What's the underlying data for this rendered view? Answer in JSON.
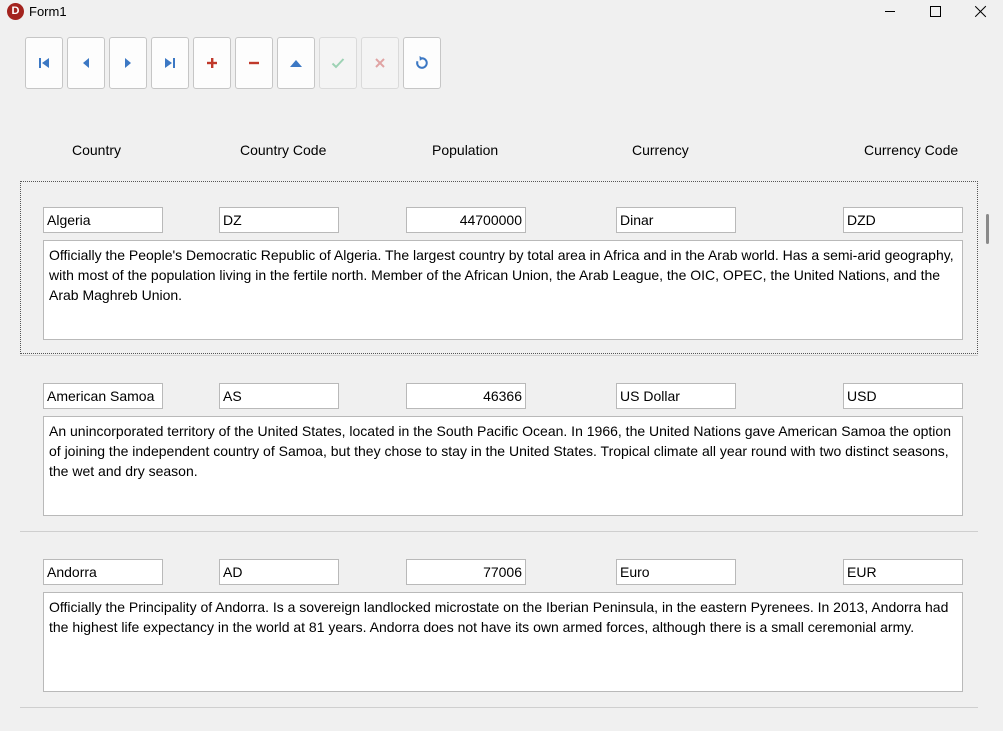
{
  "window": {
    "title": "Form1",
    "icon_letter": "D"
  },
  "navigator": {
    "buttons": [
      {
        "name": "first-record",
        "icon": "first-icon"
      },
      {
        "name": "prior-record",
        "icon": "prior-icon"
      },
      {
        "name": "next-record",
        "icon": "next-icon"
      },
      {
        "name": "last-record",
        "icon": "last-icon"
      },
      {
        "name": "insert-record",
        "icon": "plus-icon"
      },
      {
        "name": "delete-record",
        "icon": "minus-icon"
      },
      {
        "name": "edit-record",
        "icon": "up-icon"
      },
      {
        "name": "post-record",
        "icon": "check-icon",
        "enabled": false
      },
      {
        "name": "cancel-record",
        "icon": "x-icon",
        "enabled": false
      },
      {
        "name": "refresh-record",
        "icon": "refresh-icon"
      }
    ],
    "colors": {
      "nav": "#3c78c4",
      "danger": "#c0392b",
      "disabled_check": "#9dd2b4",
      "disabled_x": "#e0a3a3"
    }
  },
  "headers": {
    "country": "Country",
    "country_code": "Country Code",
    "population": "Population",
    "currency": "Currency",
    "currency_code": "Currency Code"
  },
  "records": [
    {
      "country": "Algeria",
      "country_code": "DZ",
      "population": "44700000",
      "currency": "Dinar",
      "currency_code": "DZD",
      "description": "Officially the People's Democratic Republic of Algeria. The largest country by total area in Africa and in the Arab world. Has a semi-arid geography, with most of the population living in the fertile north. Member of the African Union, the Arab League, the OIC, OPEC, the United Nations, and the Arab Maghreb Union."
    },
    {
      "country": "American Samoa",
      "country_code": "AS",
      "population": "46366",
      "currency": "US Dollar",
      "currency_code": "USD",
      "description": "An unincorporated territory of the United States, located in the South Pacific Ocean. In 1966, the United Nations gave American Samoa the option of joining the independent country of Samoa, but they chose to stay in the United States. Tropical climate all year round with two distinct seasons, the wet and dry season."
    },
    {
      "country": "Andorra",
      "country_code": "AD",
      "population": "77006",
      "currency": "Euro",
      "currency_code": "EUR",
      "description": "Officially the Principality of Andorra. Is a sovereign landlocked microstate on the Iberian Peninsula, in the eastern Pyrenees. In 2013, Andorra had the highest life expectancy in the world at 81 years. Andorra does not have its own armed forces, although there is a small ceremonial army."
    }
  ]
}
